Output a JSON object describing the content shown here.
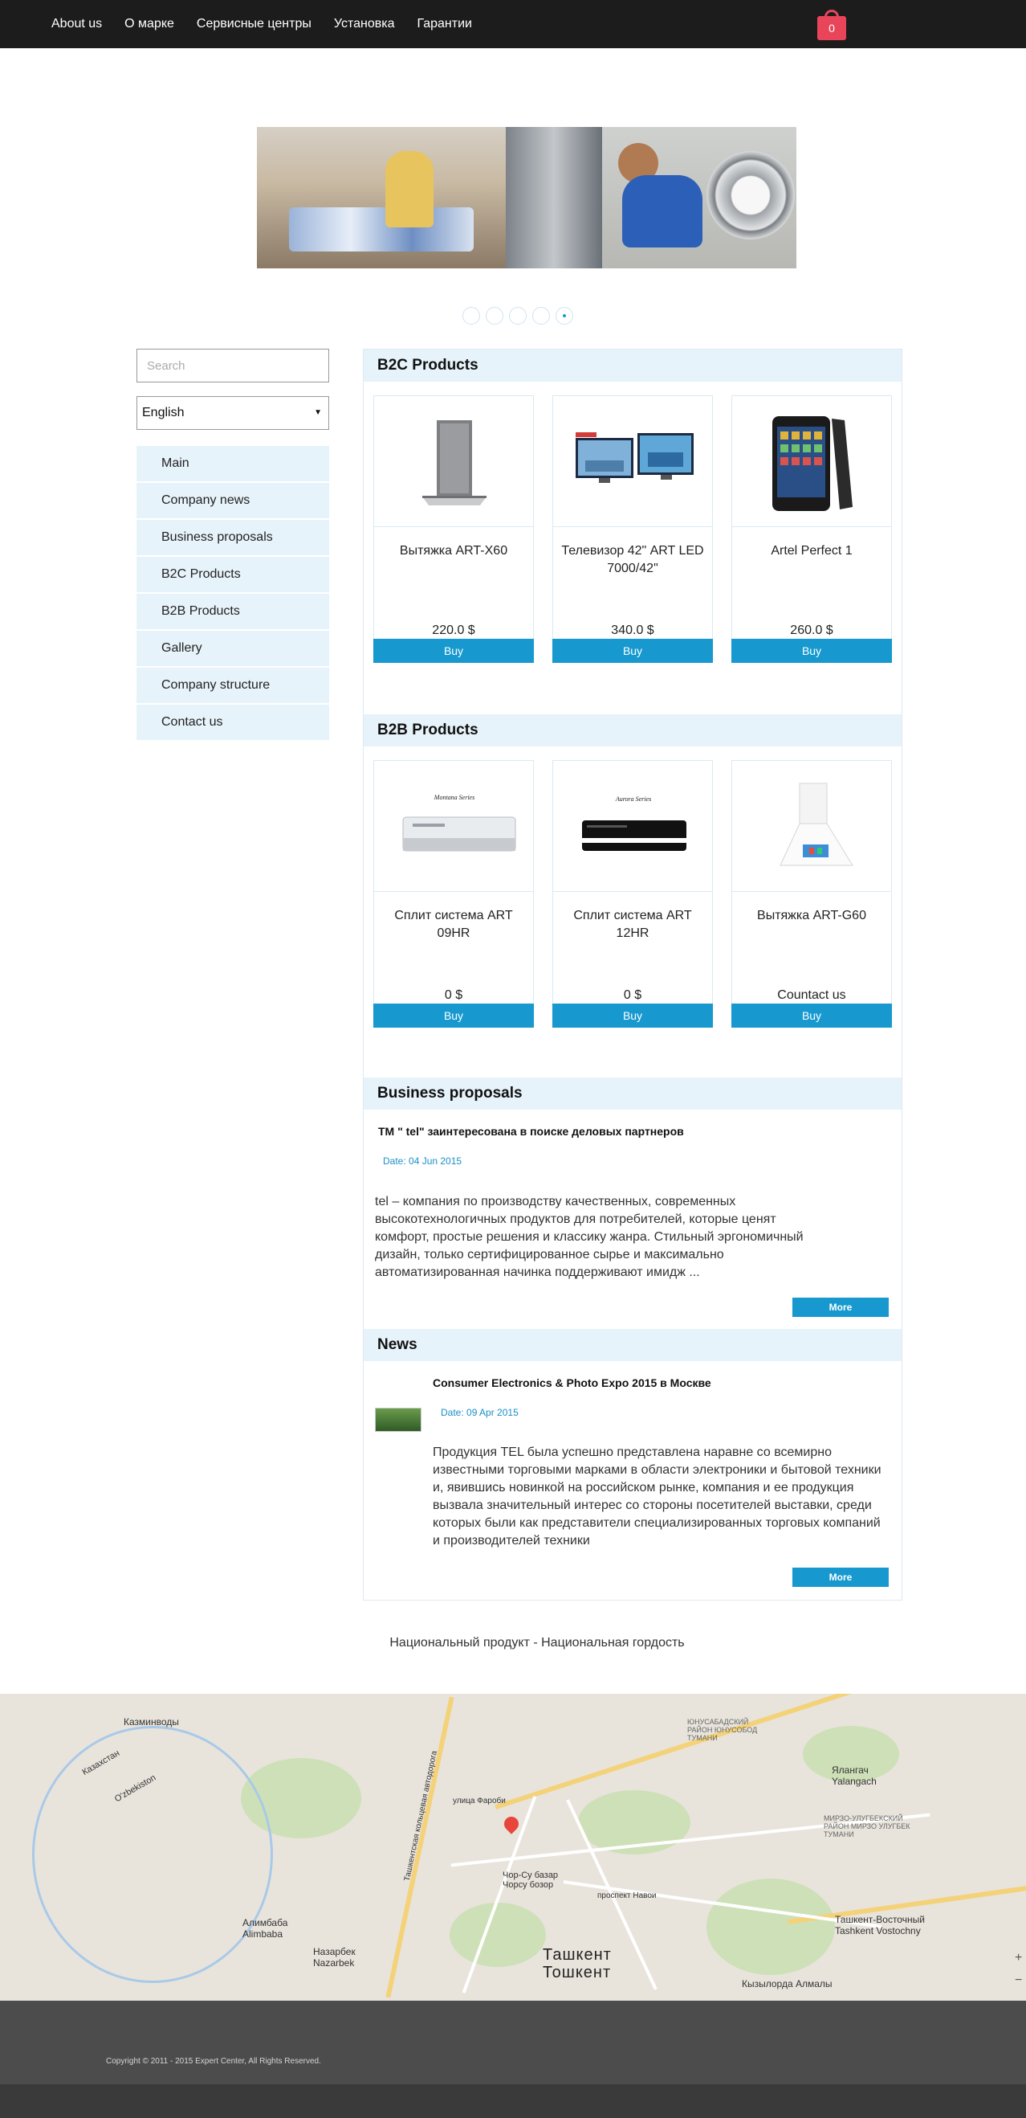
{
  "topnav": {
    "items": [
      "About us",
      "О марке",
      "Сервисные центры",
      "Установка",
      "Гарантии"
    ],
    "cart_count": "0"
  },
  "slider": {
    "dots": 5,
    "active_index": 4
  },
  "sidebar": {
    "search_placeholder": "Search",
    "language": "English",
    "menu": [
      "Main",
      "Company news",
      "Business proposals",
      "B2C Products",
      "B2B Products",
      "Gallery",
      "Company structure",
      "Contact us"
    ]
  },
  "b2c": {
    "title": "B2C Products",
    "products": [
      {
        "name": "Вытяжка ART-X60",
        "price": "220.0 $",
        "buy": "Buy"
      },
      {
        "name": "Телевизор 42\" ART LED 7000/42\"",
        "price": "340.0 $",
        "buy": "Buy"
      },
      {
        "name": "Artel Perfect 1",
        "price": "260.0 $",
        "buy": "Buy"
      }
    ]
  },
  "b2b": {
    "title": "B2B Products",
    "products": [
      {
        "name": "Сплит система ART 09HR",
        "price": "0 $",
        "buy": "Buy",
        "img_label": "Montana Series"
      },
      {
        "name": "Сплит система ART 12HR",
        "price": "0 $",
        "buy": "Buy",
        "img_label": "Aurora Series"
      },
      {
        "name": "Вытяжка ART-G60",
        "price": "Countact us",
        "buy": "Buy"
      }
    ]
  },
  "business": {
    "title": "Business proposals",
    "item_title": "TM \"     tel\" заинтересована в поиске деловых партнеров",
    "date": "Date: 04 Jun 2015",
    "text": "     tel – компания по производству качественных, современных высокотехнологичных продуктов для потребителей, которые ценят комфорт, простые решения и классику жанра. Стильный эргономичный дизайн, только сертифицированное сырье и максимально автоматизированная начинка поддерживают имидж ...",
    "more": "More"
  },
  "news": {
    "title": "News",
    "item_title": "Consumer Electronics & Photo Expo 2015 в Москве",
    "date": "Date: 09 Apr 2015",
    "text": "   Продукция       TEL была успешно представлена наравне со всемирно известными торговыми марками в области электроники и бытовой техники и, явившись новинкой на российском рынке, компания и ее продукция вызвала значительный интерес со стороны посетителей выставки, среди которых были как представители специализированных торговых компаний и производителей техники",
    "more": "More"
  },
  "slogan": "Национальный продукт - Национальная гордость",
  "map": {
    "labels": [
      "Казминводы",
      "Казахстан",
      "O'zbekiston",
      "Алимбаба Alimbaba",
      "Назарбек Nazarbek",
      "Чор-Су базар Чорсу бозор",
      "Ташкентская кольцевая автодорога",
      "ЮНУСАБАДСКИЙ РАЙОН ЮНУСОБОД ТУМАНИ",
      "Ялангач Yalangach",
      "МИРЗО-УЛУГБЕКСКИЙ РАЙОН МИРЗО УЛУГБЕК ТУМАНИ",
      "Ташкент-Восточный Tashkent Vostochny",
      "Кызылорда Алмалы",
      "улица Фароби",
      "проспект Навои"
    ],
    "city": "Ташкент",
    "city2": "Тошкент"
  },
  "footer": {
    "copyright": "Copyright © 2011 - 2015 Expert Center, All Rights Reserved."
  },
  "colors": {
    "accent": "#1799cf",
    "nav_bg": "#1c1c1c",
    "panel_bg": "#e7f3fa",
    "cart": "#e8455a",
    "footer": "#4c4c4c"
  }
}
